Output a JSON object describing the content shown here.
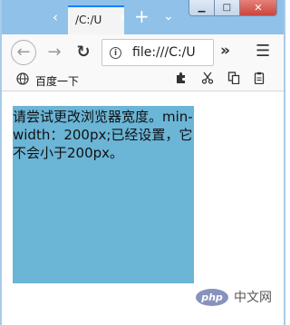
{
  "tab": {
    "label": "/C:/U"
  },
  "nav": {
    "back": "←",
    "forward": "→",
    "reload": "↻",
    "overflow": "»",
    "menu": "☰"
  },
  "urlbar": {
    "info_glyph": "i",
    "url": "file:///C:/U"
  },
  "window": {
    "minimize": "▁",
    "maximize": "□",
    "close": "✕",
    "tab_prev": "‹",
    "tab_next": "›",
    "new_tab": "+",
    "tab_list": "⌄"
  },
  "bookmarks": [
    {
      "label": "百度一下",
      "icon": "globe-icon"
    }
  ],
  "tools": {
    "extension_icon": "puzzle-icon",
    "cut_icon": "scissors-icon",
    "copy_icon": "copy-icon",
    "clipboard_icon": "clipboard-icon"
  },
  "content": {
    "text": "请尝试更改浏览器宽度。min-width：200px;已经设置，它不会小于200px。",
    "box_color": "#6bb5d6"
  },
  "watermark": {
    "logo_text": "php",
    "text": "中文网"
  }
}
